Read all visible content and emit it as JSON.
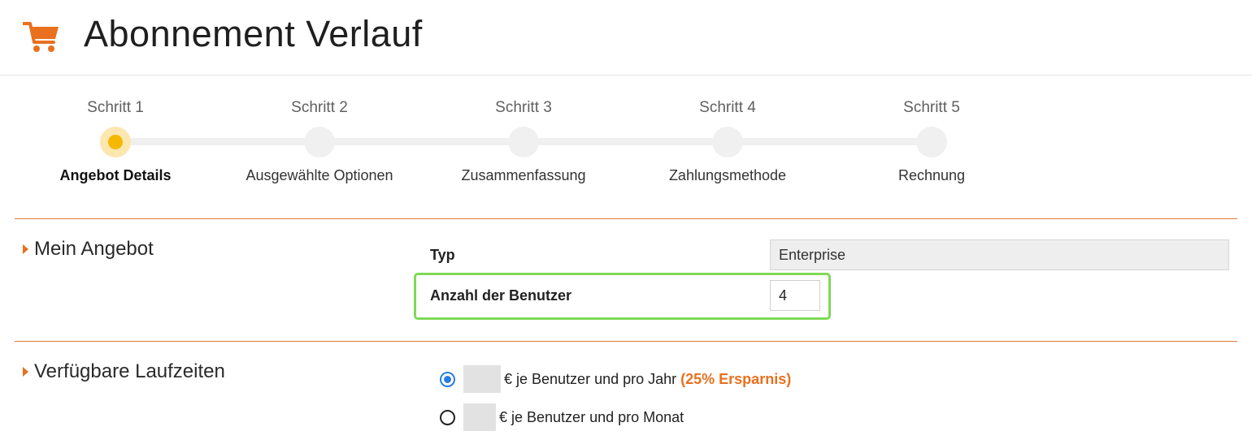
{
  "header": {
    "title": "Abonnement Verlauf",
    "icon": "shopping-cart-icon",
    "accent_color": "#e8701f"
  },
  "stepper": {
    "steps": [
      {
        "number": "Schritt 1",
        "label": "Angebot Details",
        "active": true
      },
      {
        "number": "Schritt 2",
        "label": "Ausgewählte Optionen",
        "active": false
      },
      {
        "number": "Schritt 3",
        "label": "Zusammenfassung",
        "active": false
      },
      {
        "number": "Schritt 4",
        "label": "Zahlungsmethode",
        "active": false
      },
      {
        "number": "Schritt 5",
        "label": "Rechnung",
        "active": false
      }
    ]
  },
  "offer_section": {
    "title": "Mein Angebot",
    "type_label": "Typ",
    "type_value": "Enterprise",
    "users_label": "Anzahl der Benutzer",
    "users_value": "4"
  },
  "terms_section": {
    "title": "Verfügbare Laufzeiten",
    "options": [
      {
        "text": "€ je Benutzer und pro Jahr",
        "savings": "(25% Ersparnis)",
        "selected": true
      },
      {
        "text": "€ je Benutzer und pro Monat",
        "savings": "",
        "selected": false
      }
    ]
  }
}
